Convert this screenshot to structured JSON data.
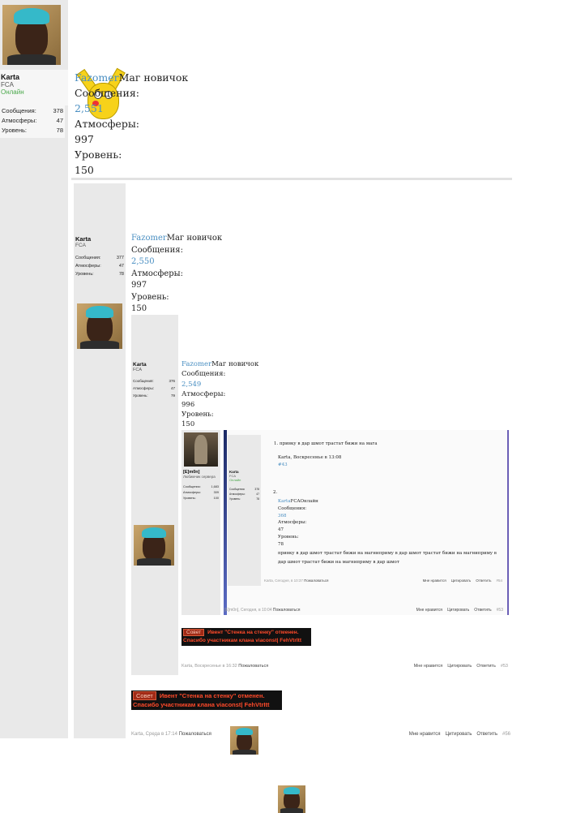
{
  "level0": {
    "user": {
      "name": "Karta",
      "group": "FCA",
      "status": "Онлайн"
    },
    "stats": [
      {
        "label": "Сообщения:",
        "value": "378"
      },
      {
        "label": "Атмосферы:",
        "value": "47"
      },
      {
        "label": "Уровень:",
        "value": "78"
      }
    ],
    "quoted": {
      "name": "Fazomer",
      "rank": "Маг новичок",
      "msgs_label": "Сообщения:",
      "msgs": "2,551",
      "atm_label": "Атмосферы:",
      "atm": "997",
      "lvl_label": "Уровень:",
      "lvl": "150"
    },
    "footer": {
      "author": "Karta, Среда в 17:14",
      "report": "Пожаловаться",
      "like": "Мне нравится",
      "quote": "Цитировать",
      "reply": "Ответить",
      "num": "#56"
    },
    "banner": {
      "tag": "Совет",
      "line1": "Ивент \"Стенка на стенку\" отменен.",
      "line2": "Спасибо участникам клана viaconst| FehVtrItt"
    }
  },
  "level1": {
    "user": {
      "name": "Karta",
      "group": "FCA"
    },
    "stats": [
      {
        "label": "Сообщения:",
        "value": "377"
      },
      {
        "label": "Атмосферы:",
        "value": "47"
      },
      {
        "label": "Уровень:",
        "value": "78"
      }
    ],
    "quoted": {
      "name": "Fazomer",
      "rank": "Маг новичок",
      "msgs_label": "Сообщения:",
      "msgs": "2,550",
      "atm_label": "Атмосферы:",
      "atm": "997",
      "lvl_label": "Уровень:",
      "lvl": "150"
    },
    "footer": {
      "author": "Karta, Воскресенье в 16:32",
      "report": "Пожаловаться",
      "like": "Мне нравится",
      "quote": "Цитировать",
      "reply": "Ответить",
      "num": "#53"
    },
    "banner": {
      "tag": "Совет",
      "line1": "Ивент \"Стенка на стенку\" отменен.",
      "line2": "Спасибо участникам клана viaconst| FehVtrItt"
    }
  },
  "level2": {
    "user": {
      "name": "Karta",
      "group": "FCA"
    },
    "stats": [
      {
        "label": "Сообщения:",
        "value": "376"
      },
      {
        "label": "Атмосферы:",
        "value": "47"
      },
      {
        "label": "Уровень:",
        "value": "79"
      }
    ],
    "quoted": {
      "name": "Fazomer",
      "rank": "Маг новичок",
      "msgs_label": "Сообщения:",
      "msgs": "2,549",
      "atm_label": "Атмосферы:",
      "atm": "996",
      "lvl_label": "Уровень:",
      "lvl": "150"
    }
  },
  "level3": {
    "user": {
      "name": "[E]m0n]",
      "group": "Любимчик сервера"
    },
    "stats": [
      {
        "label": "Сообщения:",
        "value": "1,683"
      },
      {
        "label": "Атмосферы:",
        "value": "309"
      },
      {
        "label": "Уровень:",
        "value": "100"
      }
    ],
    "footer": {
      "author": "[E]m0n], Сегодня, в 10:04",
      "report": "Пожаловаться",
      "like": "Мне нравится",
      "quote": "Цитировать",
      "reply": "Ответить",
      "num": "#53"
    }
  },
  "level4": {
    "user": {
      "name": "Karta",
      "group": "FCA",
      "status": "Онлайн"
    },
    "stats": [
      {
        "label": "Сообщения:",
        "value": "378"
      },
      {
        "label": "Атмосферы:",
        "value": "47"
      },
      {
        "label": "Уровень:",
        "value": "78"
      }
    ],
    "line1": "1. привку в дар шмот трастат бижи на мага",
    "byline": "Karta, Воскресенье в 13:08",
    "num_link": "#43",
    "item2": "2.",
    "q_name": "Karta",
    "q_group": "FCAОнлайн",
    "q_msgs_label": "Сообщения:",
    "q_msgs": "368",
    "q_atm_label": "Атмосферы:",
    "q_atm": "47",
    "q_lvl_label": "Уровень:",
    "q_lvl": "78",
    "text": "привку в дар шмот трастат бижи на магнипримy в дар шмот трастат бижи на магнипримy в дар шмот трастат бижи на магнипримy в дар шмот",
    "footer": {
      "author": "Karta, Сегодня, в 10:37",
      "report": "Пожаловаться",
      "like": "Мне нравится",
      "quote": "Цитировать",
      "reply": "Ответить",
      "num": "#54"
    }
  }
}
